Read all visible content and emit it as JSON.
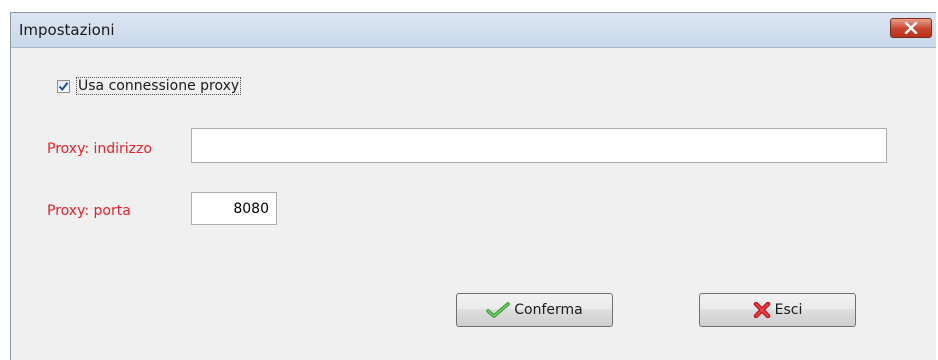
{
  "window": {
    "title": "Impostazioni",
    "close_icon": "close-icon"
  },
  "proxy": {
    "use_proxy_label": "Usa connessione proxy",
    "use_proxy_checked": true,
    "address_label": "Proxy: indirizzo",
    "address_value": "",
    "port_label": "Proxy: porta",
    "port_value": "8080"
  },
  "buttons": {
    "confirm_label": "Conferma",
    "confirm_icon": "checkmark-icon",
    "exit_label": "Esci",
    "exit_icon": "red-x-icon"
  },
  "colors": {
    "label_red": "#e8202a",
    "close_red": "#c8452f",
    "check_green": "#3aa63a"
  }
}
